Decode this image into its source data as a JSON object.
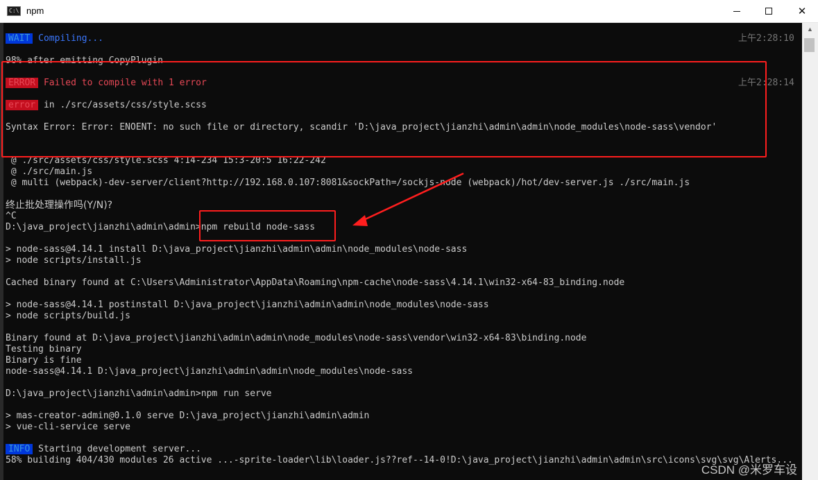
{
  "window": {
    "title": "npm",
    "app_icon_text": "C:\\"
  },
  "console": {
    "lines": [
      {
        "tag": "WAIT",
        "text": " Compiling...",
        "time": "上午2:28:10"
      },
      {
        "text": "98% after emitting CopyPlugin"
      },
      {
        "tag": "ERROR",
        "text": " Failed to compile with 1 error",
        "time": "上午2:28:14"
      },
      {
        "tag": "error",
        "text": " in ./src/assets/css/style.scss"
      },
      {
        "text": "Syntax Error: Error: ENOENT: no such file or directory, scandir 'D:\\java_project\\jianzhi\\admin\\admin\\node_modules\\node-sass\\vendor'"
      },
      {
        "text": " @ ./src/assets/css/style.scss 4:14-234 15:3-20:5 16:22-242"
      },
      {
        "text": " @ ./src/main.js"
      },
      {
        "text": " @ multi (webpack)-dev-server/client?http://192.168.0.107:8081&sockPath=/sockjs-node (webpack)/hot/dev-server.js ./src/main.js"
      },
      {
        "text": "终止批处理操作吗(Y/N)?"
      },
      {
        "text": "^C"
      },
      {
        "text": "D:\\java_project\\jianzhi\\admin\\admin>npm rebuild node-sass"
      },
      {
        "text": "> node-sass@4.14.1 install D:\\java_project\\jianzhi\\admin\\admin\\node_modules\\node-sass"
      },
      {
        "text": "> node scripts/install.js"
      },
      {
        "text": "Cached binary found at C:\\Users\\Administrator\\AppData\\Roaming\\npm-cache\\node-sass\\4.14.1\\win32-x64-83_binding.node"
      },
      {
        "text": "> node-sass@4.14.1 postinstall D:\\java_project\\jianzhi\\admin\\admin\\node_modules\\node-sass"
      },
      {
        "text": "> node scripts/build.js"
      },
      {
        "text": "Binary found at D:\\java_project\\jianzhi\\admin\\admin\\node_modules\\node-sass\\vendor\\win32-x64-83\\binding.node"
      },
      {
        "text": "Testing binary"
      },
      {
        "text": "Binary is fine"
      },
      {
        "text": "node-sass@4.14.1 D:\\java_project\\jianzhi\\admin\\admin\\node_modules\\node-sass"
      },
      {
        "text": "D:\\java_project\\jianzhi\\admin\\admin>npm run serve"
      },
      {
        "text": "> mas-creator-admin@0.1.0 serve D:\\java_project\\jianzhi\\admin\\admin"
      },
      {
        "text": "> vue-cli-service serve"
      },
      {
        "tag": "INFO",
        "text": " Starting development server..."
      },
      {
        "text": "58% building 404/430 modules 26 active ...-sprite-loader\\lib\\loader.js??ref--14-0!D:\\java_project\\jianzhi\\admin\\admin\\src\\icons\\svg\\svg\\Alerts..."
      }
    ]
  },
  "watermark": "CSDN @米罗车设",
  "colors": {
    "annotation": "#ff1e1e",
    "tag_blue": "#0037da",
    "tag_red": "#c50f1f",
    "console_bg": "#0c0c0c"
  }
}
